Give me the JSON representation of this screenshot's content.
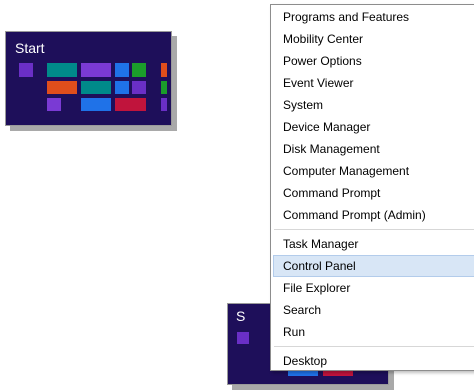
{
  "start_thumbnail": {
    "label": "Start",
    "background": "#1e0f5a"
  },
  "start_thumbnail_partial": {
    "label": "S"
  },
  "context_menu": {
    "groups": [
      [
        {
          "label": "Programs and Features"
        },
        {
          "label": "Mobility Center"
        },
        {
          "label": "Power Options"
        },
        {
          "label": "Event Viewer"
        },
        {
          "label": "System"
        },
        {
          "label": "Device Manager"
        },
        {
          "label": "Disk Management"
        },
        {
          "label": "Computer Management"
        },
        {
          "label": "Command Prompt"
        },
        {
          "label": "Command Prompt (Admin)"
        }
      ],
      [
        {
          "label": "Task Manager"
        },
        {
          "label": "Control Panel",
          "highlighted": true
        },
        {
          "label": "File Explorer"
        },
        {
          "label": "Search"
        },
        {
          "label": "Run"
        }
      ],
      [
        {
          "label": "Desktop"
        }
      ]
    ],
    "highlight_color": "#d8e6f6"
  },
  "tile_colors": {
    "purple": "#6a2fc6",
    "teal": "#008a8a",
    "violet": "#7a3ad4",
    "blue": "#1f72e8",
    "green": "#1b9c2b",
    "orange": "#e04e1c",
    "red": "#c0143c"
  }
}
